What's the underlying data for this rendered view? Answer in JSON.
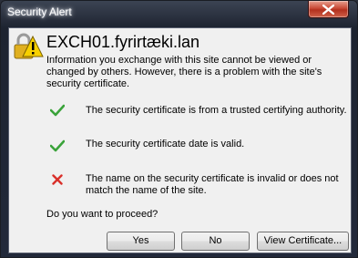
{
  "window": {
    "title": "Security Alert"
  },
  "alert": {
    "host": "EXCH01.fyrirtæki.lan",
    "info": "Information you exchange with this site cannot be viewed or changed by others. However, there is a problem with the site's security certificate.",
    "checks": [
      {
        "status": "ok",
        "icon": "check-icon",
        "text": "The security certificate is from a trusted certifying authority."
      },
      {
        "status": "ok",
        "icon": "check-icon",
        "text": "The security certificate date is valid."
      },
      {
        "status": "error",
        "icon": "x-icon",
        "text": "The name on the security certificate is invalid or does not match the name of the site."
      }
    ],
    "question": "Do you want to proceed?"
  },
  "buttons": {
    "yes": "Yes",
    "no": "No",
    "view_certificate": "View Certificate..."
  },
  "colors": {
    "ok": "#3aa33a",
    "error": "#d9302a",
    "warning": "#f2c200"
  }
}
